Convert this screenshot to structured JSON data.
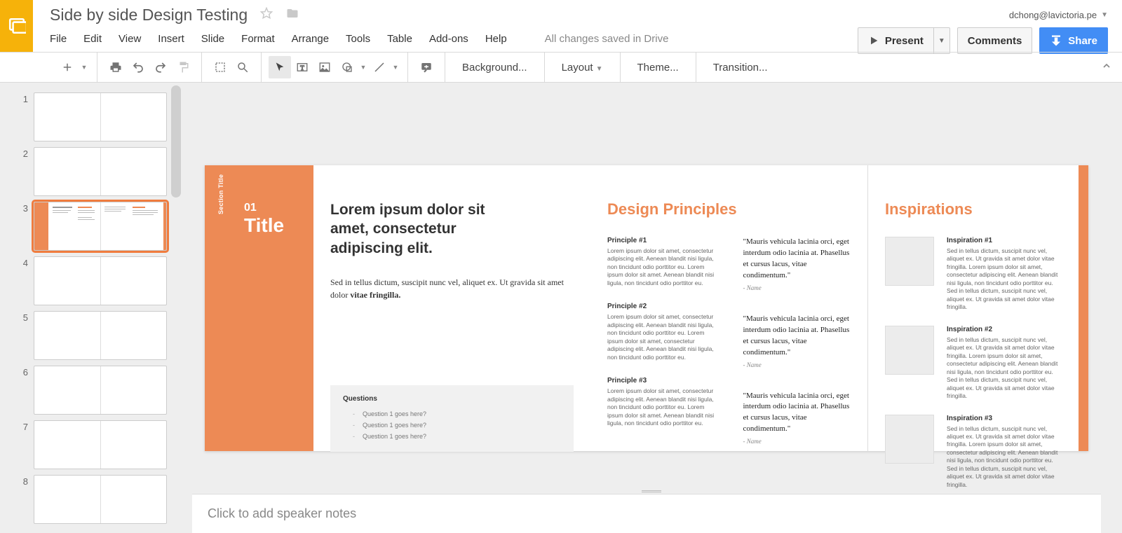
{
  "doc_title": "Side by side Design Testing",
  "user_email": "dchong@lavictoria.pe",
  "save_state": "All changes saved in Drive",
  "menus": {
    "file": "File",
    "edit": "Edit",
    "view": "View",
    "insert": "Insert",
    "slide": "Slide",
    "format": "Format",
    "arrange": "Arrange",
    "tools": "Tools",
    "table": "Table",
    "addons": "Add-ons",
    "help": "Help"
  },
  "buttons": {
    "present": "Present",
    "comments": "Comments",
    "share": "Share"
  },
  "toolbar": {
    "background": "Background...",
    "layout": "Layout",
    "theme": "Theme...",
    "transition": "Transition..."
  },
  "thumbs": [
    "1",
    "2",
    "3",
    "4",
    "5",
    "6",
    "7",
    "8"
  ],
  "selected_thumb_index": 2,
  "notes_placeholder": "Click to add speaker notes",
  "slide": {
    "section_label": "Section Title",
    "num": "01",
    "title_word": "Title",
    "big_heading": "Lorem ipsum dolor sit amet, consectetur adipiscing elit.",
    "lead": "Sed in tellus dictum, suscipit nunc vel, aliquet ex. Ut gravida sit amet dolor ",
    "lead_bold": "vitae fringilla.",
    "principles_heading": "Design Principles",
    "principles": [
      {
        "title": "Principle #1",
        "body": "Lorem ipsum dolor sit amet, consectetur adipiscing elit. Aenean blandit nisi ligula, non tincidunt odio porttitor eu. Lorem ipsum dolor sit amet. Aenean blandit nisi ligula, non tincidunt odio porttitor eu."
      },
      {
        "title": "Principle #2",
        "body": "Lorem ipsum dolor sit amet, consectetur adipiscing elit. Aenean blandit nisi ligula, non tincidunt odio porttitor eu. Lorem ipsum dolor sit amet, consectetur adipiscing elit. Aenean blandit nisi ligula, non tincidunt odio porttitor eu."
      },
      {
        "title": "Principle #3",
        "body": "Lorem ipsum dolor sit amet, consectetur adipiscing elit. Aenean blandit nisi ligula, non tincidunt odio porttitor eu. Lorem ipsum dolor sit amet. Aenean blandit nisi ligula, non tincidunt odio porttitor eu."
      }
    ],
    "quotes": [
      {
        "text": "\"Mauris vehicula lacinia orci, eget interdum odio lacinia at. Phasellus et cursus lacus, vitae condimentum.\"",
        "name": "- Name"
      },
      {
        "text": "\"Mauris vehicula lacinia orci, eget interdum odio lacinia at. Phasellus et cursus lacus, vitae condimentum.\"",
        "name": "- Name"
      },
      {
        "text": "\"Mauris vehicula lacinia orci, eget interdum odio lacinia at. Phasellus et cursus lacus, vitae condimentum.\"",
        "name": "- Name"
      }
    ],
    "questions_heading": "Questions",
    "questions": [
      "Question 1 goes here?",
      "Question 1 goes here?",
      "Question 1 goes here?"
    ],
    "inspirations_heading": "Inspirations",
    "inspirations": [
      {
        "title": "Inspiration #1",
        "body": "Sed in tellus dictum, suscipit nunc vel, aliquet ex. Ut gravida sit amet dolor vitae fringilla. Lorem ipsum dolor sit amet, consectetur adipiscing elit. Aenean blandit nisi ligula, non tincidunt odio porttitor eu. Sed in tellus dictum, suscipit nunc vel, aliquet ex. Ut gravida sit amet dolor vitae fringilla."
      },
      {
        "title": "Inspiration #2",
        "body": "Sed in tellus dictum, suscipit nunc vel, aliquet ex. Ut gravida sit amet dolor vitae fringilla. Lorem ipsum dolor sit amet, consectetur adipiscing elit. Aenean blandit nisi ligula, non tincidunt odio porttitor eu. Sed in tellus dictum, suscipit nunc vel, aliquet ex. Ut gravida sit amet dolor vitae fringilla."
      },
      {
        "title": "Inspiration #3",
        "body": "Sed in tellus dictum, suscipit nunc vel, aliquet ex. Ut gravida sit amet dolor vitae fringilla. Lorem ipsum dolor sit amet, consectetur adipiscing elit. Aenean blandit nisi ligula, non tincidunt odio porttitor eu. Sed in tellus dictum, suscipit nunc vel, aliquet ex. Ut gravida sit amet dolor vitae fringilla."
      }
    ]
  }
}
